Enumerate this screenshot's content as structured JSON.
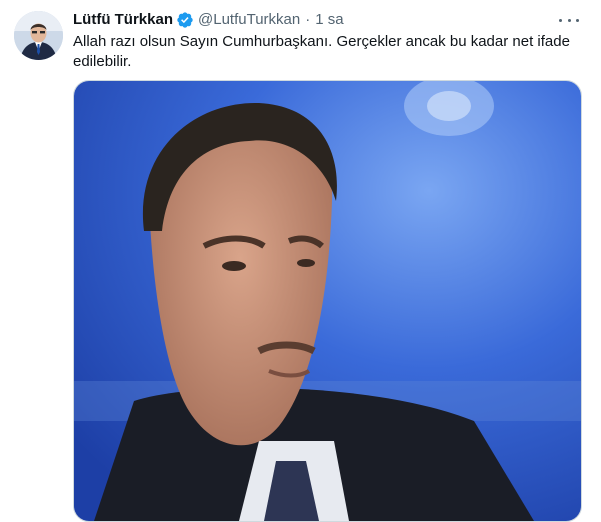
{
  "tweet": {
    "author_name": "Lütfü Türkkan",
    "handle": "@LutfuTurkkan",
    "separator": "·",
    "time": "1 sa",
    "text": "Allah razı olsun Sayın Cumhurbaşkanı. Gerçekler ancak bu kadar net ifade edilebilir.",
    "verified": true
  },
  "colors": {
    "verified_blue": "#1d9bf0",
    "secondary_text": "#536471",
    "media_background": "#2f5fd0"
  },
  "icons": {
    "verified": "verified-badge-icon",
    "more": "more-options-icon"
  }
}
